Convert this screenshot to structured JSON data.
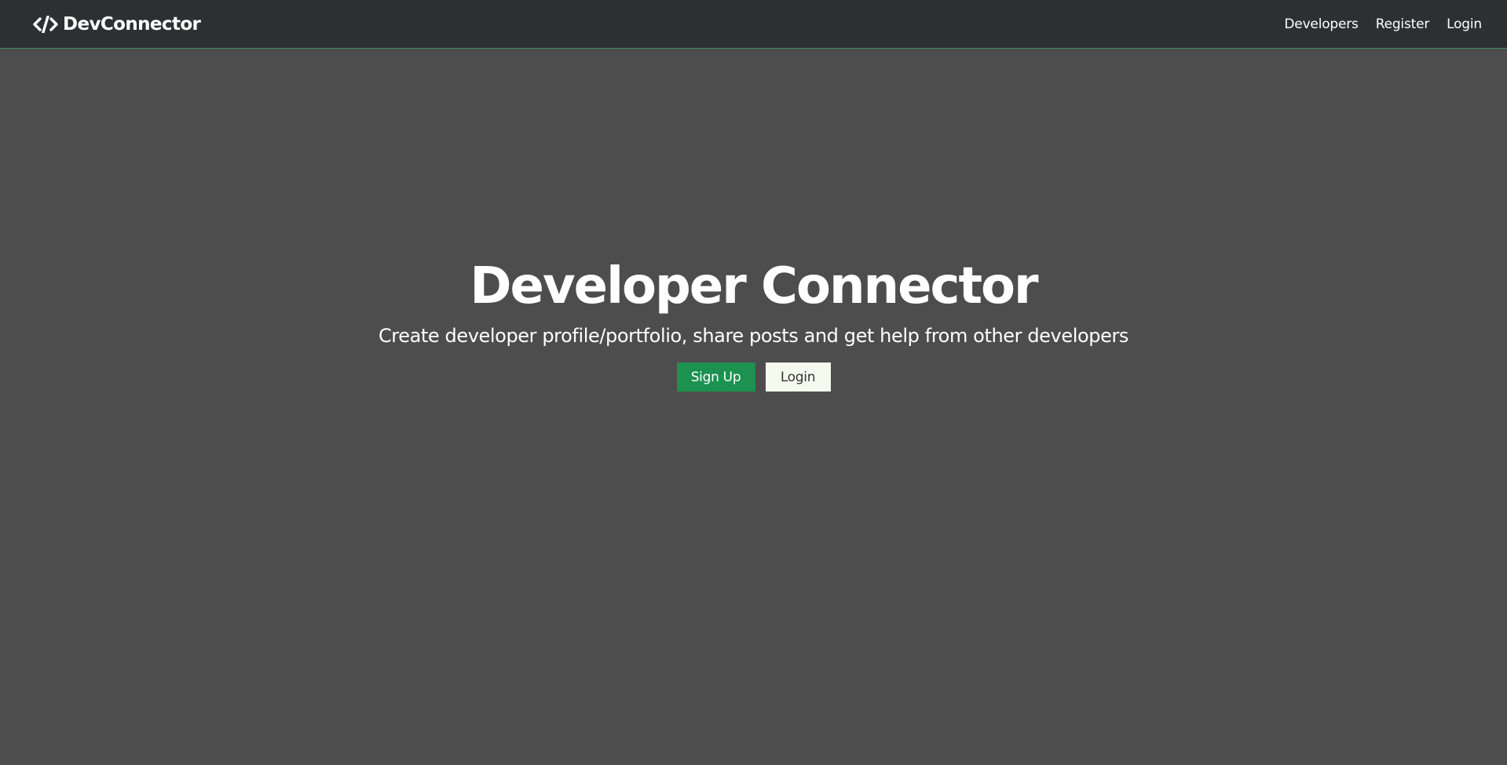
{
  "navbar": {
    "brand_icon": "code-icon",
    "brand_text": "DevConnector",
    "links": [
      {
        "label": "Developers"
      },
      {
        "label": "Register"
      },
      {
        "label": "Login"
      }
    ]
  },
  "hero": {
    "title": "Developer Connector",
    "lead": "Create developer profile/portfolio, share posts and get help from other developers",
    "signup_label": "Sign Up",
    "login_label": "Login"
  },
  "colors": {
    "navbar_bg": "#2e2f31",
    "page_bg": "#4d4d4d",
    "primary": "#1c9150",
    "light": "#f5faef"
  }
}
